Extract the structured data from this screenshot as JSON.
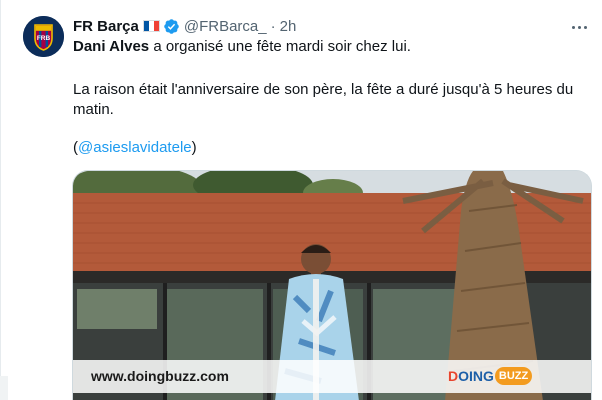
{
  "tweet": {
    "author_name": "FR Barça",
    "handle": "@FRBarca_",
    "separator": "·",
    "time": "2h",
    "avatar_text": "FRB",
    "line1_bold": "Dani Alves",
    "line1_rest": " a organisé une fête mardi soir chez lui.",
    "line2": "La raison était l'anniversaire de son père, la fête a duré jusqu'à 5 heures du",
    "line3": "matin.",
    "paren_open": "(",
    "mention": "@asieslavidatele",
    "paren_close": ")"
  },
  "icons": {
    "flag": "france-flag-icon",
    "verified": "verified-badge-icon",
    "more": "more-options-icon"
  },
  "media": {
    "watermark_url": "www.doingbuzz.com",
    "logo_d": "D",
    "logo_rest": "OING",
    "logo_badge": "BUZZ"
  },
  "colors": {
    "verified": "#1d9bf0",
    "mention": "#1d9bf0",
    "flag_blue": "#0055a4",
    "flag_white": "#ffffff",
    "flag_red": "#ef4135"
  }
}
